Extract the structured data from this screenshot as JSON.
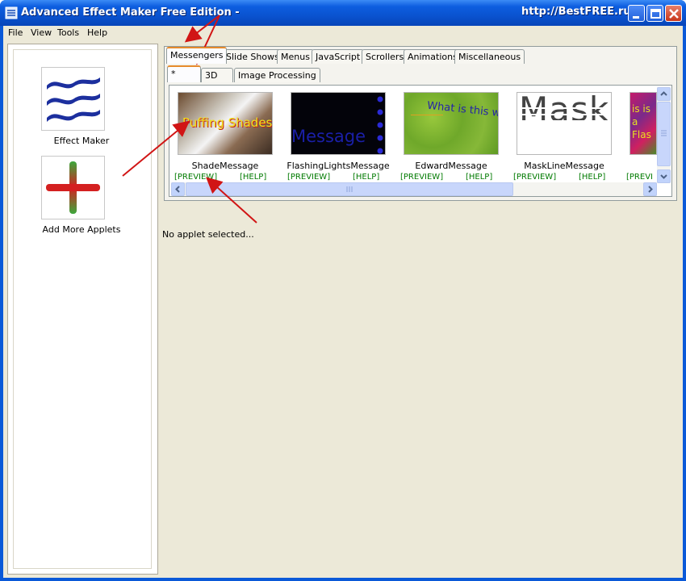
{
  "window": {
    "title": "Advanced Effect Maker Free Edition -",
    "watermark": "http://BestFREE.ru"
  },
  "menu": [
    "File",
    "View",
    "Tools",
    "Help"
  ],
  "sidebar": {
    "items": [
      {
        "label": "Effect Maker",
        "icon": "waves-icon"
      },
      {
        "label": "Add More Applets",
        "icon": "plus-icon"
      }
    ]
  },
  "tabs": {
    "main": [
      "Messengers",
      "Slide Shows",
      "Menus",
      "JavaScript",
      "Scrollers",
      "Animations",
      "Miscellaneous"
    ],
    "sub": [
      "*",
      "3D",
      "Image Processing"
    ]
  },
  "applets": [
    {
      "name": "ShadeMessage",
      "preview_text": "Puffing Shades",
      "preview": "[PREVIEW]",
      "help": "[HELP]"
    },
    {
      "name": "FlashingLightsMessage",
      "preview_text": "Message",
      "preview": "[PREVIEW]",
      "help": "[HELP]"
    },
    {
      "name": "EdwardMessage",
      "preview_text": "What is this wei",
      "preview": "[PREVIEW]",
      "help": "[HELP]"
    },
    {
      "name": "MaskLineMessage",
      "preview_text": "MaskL",
      "preview": "[PREVIEW]",
      "help": "[HELP]"
    },
    {
      "name": "",
      "preview_text": "is is a Flas",
      "preview": "[PREVI",
      "help": ""
    }
  ],
  "status": "No applet selected...",
  "colors": {
    "titlebar": "#0A53D0",
    "chrome": "#ECE9D8",
    "link": "#007A00",
    "annotation": "#D11515"
  }
}
